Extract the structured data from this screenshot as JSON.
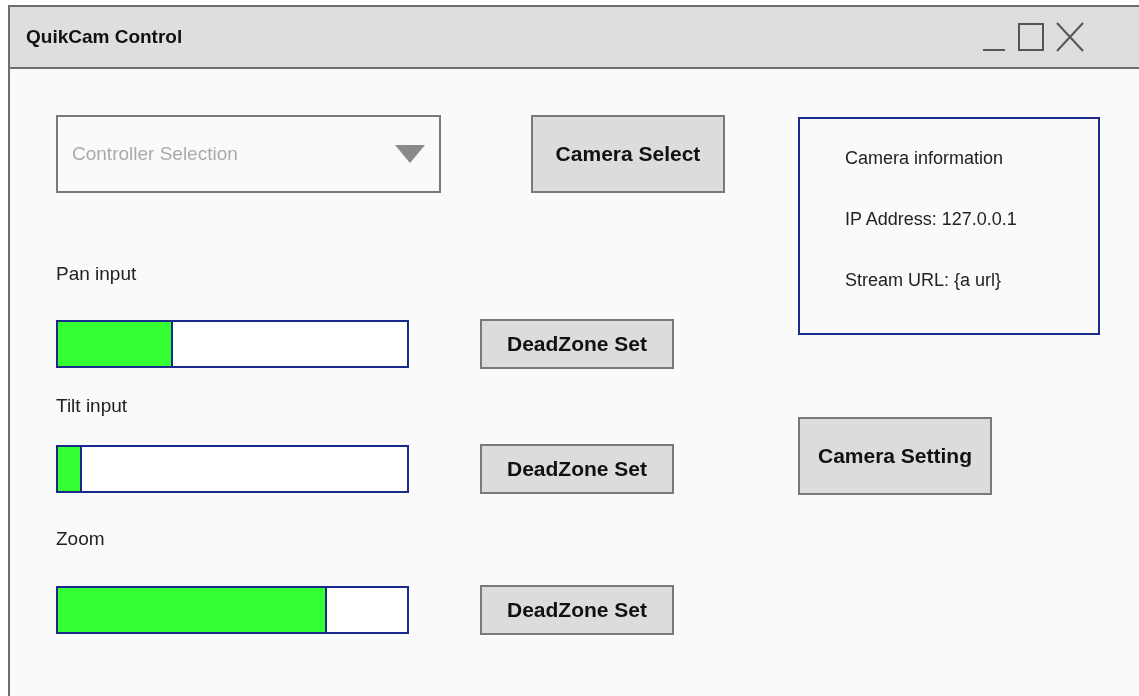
{
  "window": {
    "title": "QuikCam Control"
  },
  "controller_dropdown": {
    "placeholder": "Controller Selection"
  },
  "camera_select_button": "Camera Select",
  "inputs": [
    {
      "label": "Pan input",
      "level": 0.33,
      "button": "DeadZone Set"
    },
    {
      "label": "Tilt input",
      "level": 0.07,
      "button": "DeadZone Set"
    },
    {
      "label": "Zoom",
      "level": 0.77,
      "button": "DeadZone Set"
    }
  ],
  "camera_info": {
    "title": "Camera information",
    "lines": [
      "IP Address: 127.0.0.1",
      "Stream URL: {a url}"
    ]
  },
  "camera_setting_button": "Camera Setting"
}
